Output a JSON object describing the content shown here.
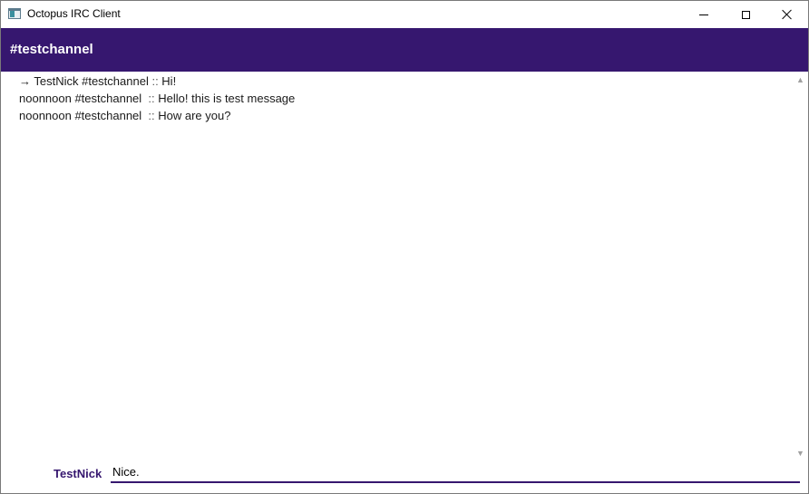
{
  "window": {
    "title": "Octopus IRC Client",
    "icon": "app-window-icon"
  },
  "channel": {
    "name": "#testchannel"
  },
  "messages": [
    {
      "prefix": "→ TestNick #testchannel",
      "sep": " :: ",
      "text": "Hi!"
    },
    {
      "prefix": "noonnoon #testchannel ",
      "sep": " :: ",
      "text": "Hello! this is test message"
    },
    {
      "prefix": "noonnoon #testchannel ",
      "sep": " :: ",
      "text": "How are you?"
    }
  ],
  "input": {
    "nick": "TestNick",
    "value": "Nice."
  },
  "colors": {
    "accent": "#36176f"
  }
}
